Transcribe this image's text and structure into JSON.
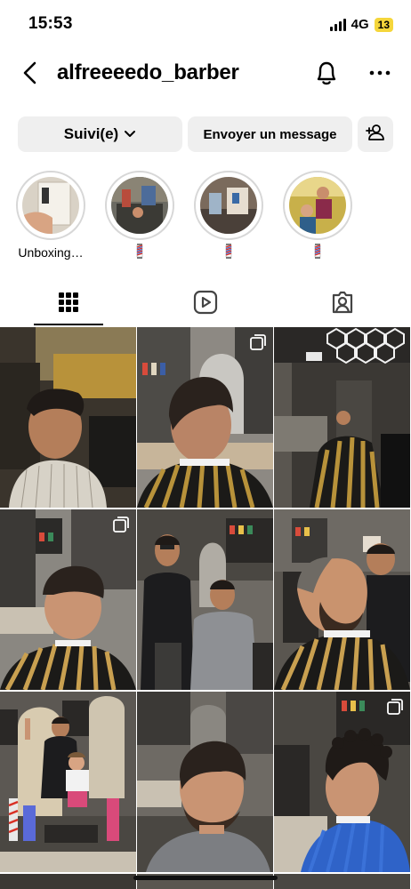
{
  "status_bar": {
    "time": "15:53",
    "network": "4G",
    "battery": "13",
    "battery_color": "#f5d63b"
  },
  "header": {
    "username": "alfreeeedo_barber",
    "back_icon": "chevron-left-icon",
    "notification_icon": "bell-icon",
    "more_icon": "ellipsis-icon"
  },
  "actions": {
    "follow_label": "Suivi(e)",
    "message_label": "Envoyer un message",
    "add_user_icon": "person-add-icon"
  },
  "highlights": [
    {
      "label": "Unboxing…",
      "type": "text"
    },
    {
      "label": "barber-pole",
      "type": "icon"
    },
    {
      "label": "barber-pole",
      "type": "icon"
    },
    {
      "label": "barber-pole",
      "type": "icon"
    }
  ],
  "tabs": [
    {
      "name": "posts-grid",
      "icon": "grid-icon",
      "active": true
    },
    {
      "name": "reels",
      "icon": "reels-icon",
      "active": false
    },
    {
      "name": "tagged",
      "icon": "tagged-person-icon",
      "active": false
    }
  ],
  "posts": [
    {
      "multi": false
    },
    {
      "multi": true
    },
    {
      "multi": true
    },
    {
      "multi": true
    },
    {
      "multi": false
    },
    {
      "multi": false
    },
    {
      "multi": false
    },
    {
      "multi": false
    },
    {
      "multi": true
    }
  ],
  "colors": {
    "button_bg": "#efefef",
    "cape_gold": "#b8923a",
    "cape_black": "#1b1a18",
    "skin": "#c98e6c",
    "hair": "#1f1a17"
  }
}
